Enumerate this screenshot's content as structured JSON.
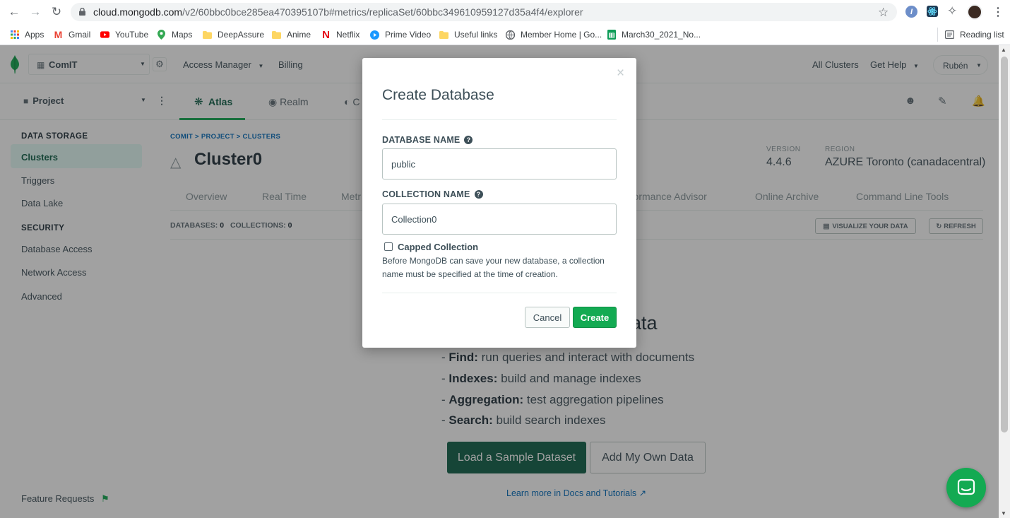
{
  "browser": {
    "url_host": "cloud.mongodb.com",
    "url_path": "/v2/60bbc0bce285ea470395107b#metrics/replicaSet/60bbc349610959127d35a4f4/explorer"
  },
  "bookmarks": [
    {
      "label": "Apps",
      "icon": "apps-grid-icon"
    },
    {
      "label": "Gmail",
      "icon": "gmail-icon"
    },
    {
      "label": "YouTube",
      "icon": "youtube-icon"
    },
    {
      "label": "Maps",
      "icon": "maps-pin-icon"
    },
    {
      "label": "DeepAssure",
      "icon": "folder-icon"
    },
    {
      "label": "Anime",
      "icon": "folder-icon"
    },
    {
      "label": "Netflix",
      "icon": "netflix-icon"
    },
    {
      "label": "Prime Video",
      "icon": "prime-video-icon"
    },
    {
      "label": "Useful links",
      "icon": "folder-icon"
    },
    {
      "label": "Member Home | Go...",
      "icon": "globe-icon"
    },
    {
      "label": "March30_2021_No...",
      "icon": "sheets-icon"
    }
  ],
  "reading_list": "Reading list",
  "topnav": {
    "org": "ComIT",
    "access_manager": "Access Manager",
    "billing": "Billing",
    "all_clusters": "All Clusters",
    "get_help": "Get Help",
    "user": "Rubén"
  },
  "projnav": {
    "project": "Project",
    "tabs": [
      "Atlas",
      "Realm",
      "C"
    ]
  },
  "sidebar": {
    "data_storage_header": "DATA STORAGE",
    "items_storage": [
      "Clusters",
      "Triggers",
      "Data Lake"
    ],
    "security_header": "SECURITY",
    "items_security": [
      "Database Access",
      "Network Access",
      "Advanced"
    ],
    "feature_requests": "Feature Requests"
  },
  "main": {
    "breadcrumb": "COMIT > PROJECT > CLUSTERS",
    "cluster_name": "Cluster0",
    "version_label": "VERSION",
    "version_value": "4.4.6",
    "region_label": "REGION",
    "region_value": "AZURE Toronto (canadacentral)",
    "tabs": [
      "Overview",
      "Real Time",
      "Metr",
      "rformance Advisor",
      "Online Archive",
      "Command Line Tools"
    ],
    "databases_label": "DATABASES:",
    "databases_count": "0",
    "collections_label": "COLLECTIONS:",
    "collections_count": "0",
    "visualize_button": "VISUALIZE YOUR DATA",
    "refresh_button": "REFRESH",
    "hero_title_fragment": "ata",
    "features": [
      {
        "key": "Find:",
        "text": "run queries and interact with documents"
      },
      {
        "key": "Indexes:",
        "text": "build and manage indexes"
      },
      {
        "key": "Aggregation:",
        "text": "test aggregation pipelines"
      },
      {
        "key": "Search:",
        "text": "build search indexes"
      }
    ],
    "load_sample_button": "Load a Sample Dataset",
    "add_data_button": "Add My Own Data",
    "learn_more_link": "Learn more in Docs and Tutorials"
  },
  "modal": {
    "title": "Create Database",
    "db_name_label": "DATABASE NAME",
    "db_name_value": "public",
    "collection_name_label": "COLLECTION NAME",
    "collection_name_value": "Collection0",
    "capped_label": "Capped Collection",
    "capped_checked": false,
    "help_text": "Before MongoDB can save your new database, a collection name must be specified at the time of creation.",
    "cancel_button": "Cancel",
    "create_button": "Create"
  },
  "colors": {
    "mongo_green": "#13aa52",
    "dark_green": "#116149",
    "link_blue": "#006cbc",
    "chat_green": "#13aa52"
  }
}
